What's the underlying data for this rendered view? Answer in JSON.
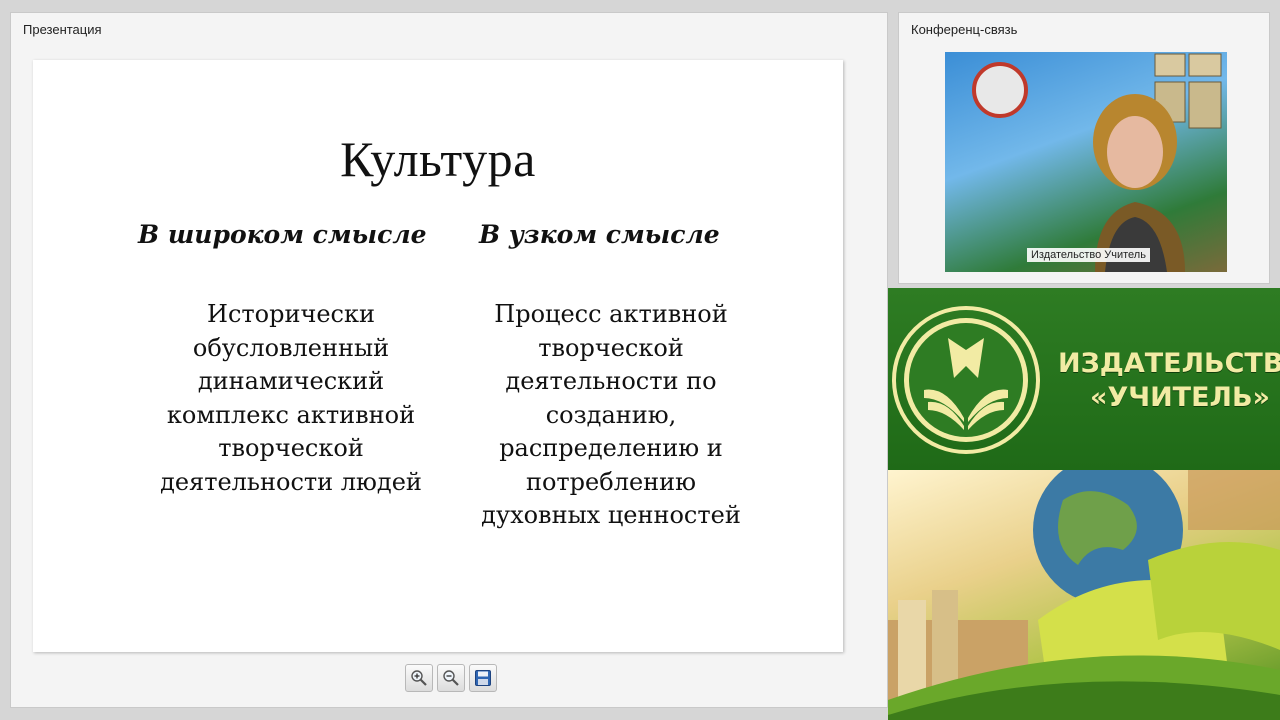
{
  "presentation": {
    "panel_title": "Презентация",
    "slide": {
      "title": "Культура",
      "left_heading": "В широком смысле",
      "right_heading": "В узком смысле",
      "left_lines": [
        "Исторически",
        "обусловленный",
        "динамический",
        "комплекс активной",
        "творческой",
        "деятельности людей"
      ],
      "right_lines": [
        "Процесс активной",
        "творческой",
        "деятельности по",
        "созданию,",
        "распределению и",
        "потреблению",
        "духовных ценностей"
      ]
    },
    "toolbar": {
      "zoom_in_icon": "zoom-in-icon",
      "zoom_out_icon": "zoom-out-icon",
      "save_icon": "save-icon"
    }
  },
  "conference": {
    "panel_title": "Конференц-связь",
    "participant_name": "Издательство Учитель"
  },
  "banner": {
    "line1": "ИЗДАТЕЛЬСТВО",
    "line2": "«УЧИТЕЛЬ»"
  },
  "colors": {
    "banner_green": "#2e7c23",
    "banner_text": "#f2eba4"
  }
}
